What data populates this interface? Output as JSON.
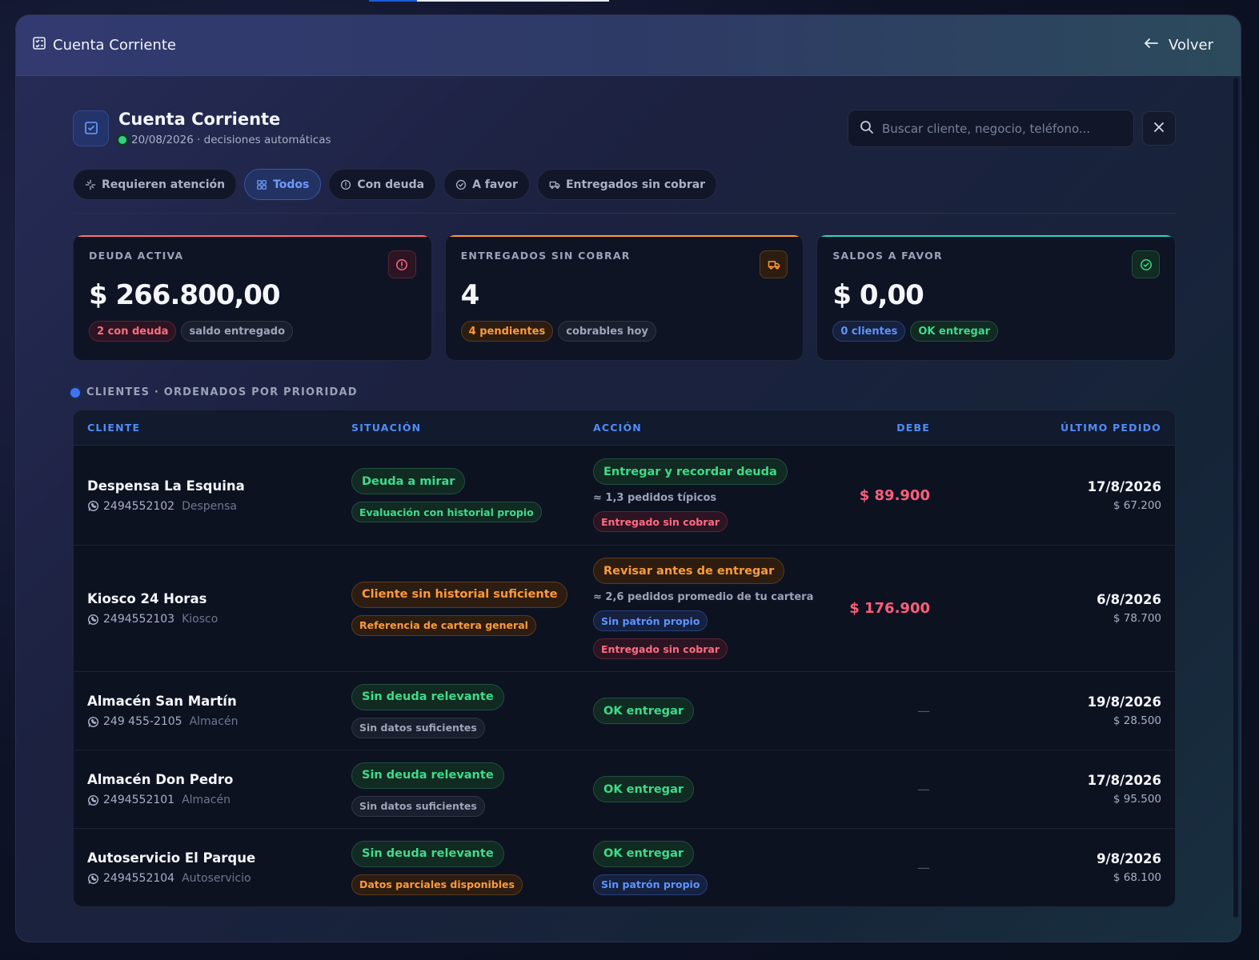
{
  "window": {
    "title": "Cuenta Corriente",
    "back_label": "Volver"
  },
  "header": {
    "title": "Cuenta Corriente",
    "subtitle": "20/08/2026 · decisiones automáticas",
    "search_placeholder": "Buscar cliente, negocio, teléfono..."
  },
  "filters": [
    {
      "label": "Requieren atención",
      "icon": "sparkle-icon",
      "active": false
    },
    {
      "label": "Todos",
      "icon": "grid-icon",
      "active": true
    },
    {
      "label": "Con deuda",
      "icon": "alert-circle-icon",
      "active": false
    },
    {
      "label": "A favor",
      "icon": "check-circle-icon",
      "active": false
    },
    {
      "label": "Entregados sin cobrar",
      "icon": "truck-icon",
      "active": false
    }
  ],
  "cards": [
    {
      "label": "DEUDA ACTIVA",
      "value": "$ 266.800,00",
      "icon": "alert-circle-icon",
      "accent": "#ff6b83",
      "pills": [
        {
          "text": "2 con deuda",
          "style": "red"
        },
        {
          "text": "saldo entregado",
          "style": "gray"
        }
      ]
    },
    {
      "label": "ENTREGADOS SIN COBRAR",
      "value": "4",
      "icon": "truck-icon",
      "accent": "#ff9a3c",
      "pills": [
        {
          "text": "4 pendientes",
          "style": "orange"
        },
        {
          "text": "cobrables hoy",
          "style": "gray"
        }
      ]
    },
    {
      "label": "SALDOS A FAVOR",
      "value": "$ 0,00",
      "icon": "check-circle-icon",
      "accent": "#2fd2c5",
      "pills": [
        {
          "text": "0 clientes",
          "style": "blue"
        },
        {
          "text": "OK entregar",
          "style": "green"
        }
      ]
    }
  ],
  "section_title": "CLIENTES · ORDENADOS POR PRIORIDAD",
  "table": {
    "columns": [
      "CLIENTE",
      "SITUACIÓN",
      "ACCIÓN",
      "DEBE",
      "ÚLTIMO PEDIDO"
    ],
    "rows": [
      {
        "name": "Despensa La Esquina",
        "phone": "2494552102",
        "type": "Despensa",
        "situation": [
          {
            "text": "Deuda a mirar",
            "style": "green",
            "size": "big"
          },
          {
            "text": "Evaluación con historial propio",
            "style": "green",
            "size": "small"
          }
        ],
        "action": [
          {
            "text": "Entregar y recordar deuda",
            "style": "green",
            "size": "big"
          },
          {
            "text": "≈ 1,3 pedidos típicos",
            "style": "note"
          },
          {
            "text": "Entregado sin cobrar",
            "style": "red",
            "size": "small"
          }
        ],
        "debe": "$ 89.900",
        "last_date": "17/8/2026",
        "last_amount": "$ 67.200"
      },
      {
        "name": "Kiosco 24 Horas",
        "phone": "2494552103",
        "type": "Kiosco",
        "situation": [
          {
            "text": "Cliente sin historial suficiente",
            "style": "orange",
            "size": "big"
          },
          {
            "text": "Referencia de cartera general",
            "style": "orange",
            "size": "small"
          }
        ],
        "action": [
          {
            "text": "Revisar antes de entregar",
            "style": "orange",
            "size": "big"
          },
          {
            "text": "≈ 2,6 pedidos promedio de tu cartera",
            "style": "note"
          },
          {
            "text": "Sin patrón propio",
            "style": "blue",
            "size": "small"
          },
          {
            "text": "Entregado sin cobrar",
            "style": "red",
            "size": "small"
          }
        ],
        "debe": "$ 176.900",
        "last_date": "6/8/2026",
        "last_amount": "$ 78.700"
      },
      {
        "name": "Almacén San Martín",
        "phone": "249 455-2105",
        "type": "Almacén",
        "situation": [
          {
            "text": "Sin deuda relevante",
            "style": "green",
            "size": "big"
          },
          {
            "text": "Sin datos suficientes",
            "style": "gray",
            "size": "small"
          }
        ],
        "action": [
          {
            "text": "OK entregar",
            "style": "green",
            "size": "big"
          }
        ],
        "debe": "—",
        "last_date": "19/8/2026",
        "last_amount": "$ 28.500"
      },
      {
        "name": "Almacén Don Pedro",
        "phone": "2494552101",
        "type": "Almacén",
        "situation": [
          {
            "text": "Sin deuda relevante",
            "style": "green",
            "size": "big"
          },
          {
            "text": "Sin datos suficientes",
            "style": "gray",
            "size": "small"
          }
        ],
        "action": [
          {
            "text": "OK entregar",
            "style": "green",
            "size": "big"
          }
        ],
        "debe": "—",
        "last_date": "17/8/2026",
        "last_amount": "$ 95.500"
      },
      {
        "name": "Autoservicio El Parque",
        "phone": "2494552104",
        "type": "Autoservicio",
        "situation": [
          {
            "text": "Sin deuda relevante",
            "style": "green",
            "size": "big"
          },
          {
            "text": "Datos parciales disponibles",
            "style": "orange",
            "size": "small"
          }
        ],
        "action": [
          {
            "text": "OK entregar",
            "style": "green",
            "size": "big"
          },
          {
            "text": "Sin patrón propio",
            "style": "blue",
            "size": "small"
          }
        ],
        "debe": "—",
        "last_date": "9/8/2026",
        "last_amount": "$ 68.100"
      }
    ]
  }
}
